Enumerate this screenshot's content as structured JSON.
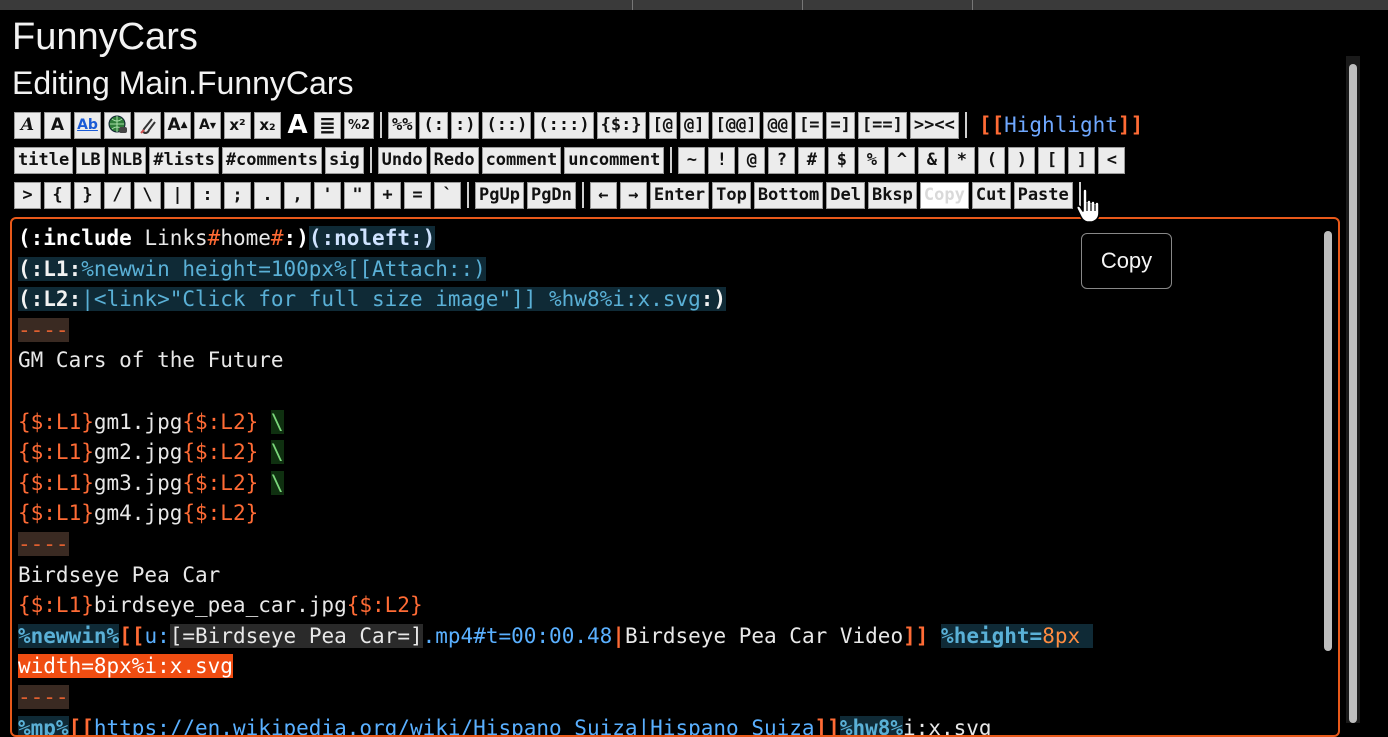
{
  "page": {
    "site_title": "FunnyCars",
    "edit_title": "Editing Main.FunnyCars"
  },
  "toolbar": {
    "row1_icons": [
      {
        "label": "A",
        "icon": "italic-icon"
      },
      {
        "label": "A",
        "icon": "bold-icon"
      },
      {
        "label": "Ab",
        "icon": "underline-icon"
      },
      {
        "label": "",
        "icon": "link-globe-icon"
      },
      {
        "label": "",
        "icon": "attach-paperclip-icon"
      },
      {
        "label": "A",
        "icon": "bigger-text-icon"
      },
      {
        "label": "A",
        "icon": "smaller-text-icon"
      },
      {
        "label": "x²",
        "icon": "superscript-icon"
      },
      {
        "label": "x₂",
        "icon": "subscript-icon"
      },
      {
        "label": "A",
        "icon": "large-text-icon"
      },
      {
        "label": "≣",
        "icon": "center-align-icon"
      },
      {
        "label": "%2",
        "icon": "percent-style-icon"
      }
    ],
    "row1_pairs": [
      "%%",
      "(:",
      ":)",
      "(::)",
      "(:::)",
      "{$:}",
      "[@",
      "@]",
      "[@@]",
      "@@",
      "[=",
      "=]",
      "[==]",
      ">><<"
    ],
    "highlight": {
      "open": "[[",
      "label": "Highlight",
      "close": "]]"
    },
    "row2_cmds": [
      "title",
      "LB",
      "NLB",
      "#lists",
      "#comments",
      "sig"
    ],
    "row2_edit": [
      "Undo",
      "Redo",
      "comment",
      "uncomment"
    ],
    "row2_chars": [
      "~",
      "!",
      "@",
      "?",
      "#",
      "$",
      "%",
      "^",
      "&",
      "*",
      "(",
      ")",
      "[",
      "]",
      "<"
    ],
    "row3_chars": [
      ">",
      "{",
      "}",
      "/",
      "\\",
      "|",
      ":",
      ";",
      ".",
      ",",
      "'",
      "\"",
      "+",
      "=",
      "`"
    ],
    "row3_nav": [
      "PgUp",
      "PgDn"
    ],
    "row3_keys": [
      "←",
      "→",
      "Enter",
      "Top",
      "Bottom",
      "Del",
      "Bksp",
      "Copy",
      "Cut",
      "Paste"
    ]
  },
  "tooltip": {
    "text": "Copy"
  },
  "editor": {
    "lines": [
      [
        {
          "t": "(:include",
          "c": "inc"
        },
        {
          "t": " Links",
          "c": ""
        },
        {
          "t": "#",
          "c": "hash"
        },
        {
          "t": "home",
          "c": ""
        },
        {
          "t": "#",
          "c": "hash"
        },
        {
          "t": ":)",
          "c": "inc"
        },
        {
          "t": "(:noleft:)",
          "c": "d"
        }
      ],
      [
        {
          "t": "(:L1:",
          "c": "dp"
        },
        {
          "t": "%newwin height=100px%[[Attach::)",
          "c": "dv"
        }
      ],
      [
        {
          "t": "(:L2:",
          "c": "dp"
        },
        {
          "t": "|<link>\"Click for full size image\"]] %hw8%i:x.svg",
          "c": "dv"
        },
        {
          "t": ":)",
          "c": "dp"
        }
      ],
      [
        {
          "t": "----",
          "c": "hr"
        }
      ],
      [
        {
          "t": "GM Cars of the Future",
          "c": ""
        }
      ],
      [
        {
          "t": "",
          "c": ""
        }
      ],
      [
        {
          "t": "{$:L1}",
          "c": "ph"
        },
        {
          "t": "gm1.jpg",
          "c": ""
        },
        {
          "t": "{$:L2}",
          "c": "ph"
        },
        {
          "t": " ",
          "c": ""
        },
        {
          "t": "\\",
          "c": "bs"
        }
      ],
      [
        {
          "t": "{$:L1}",
          "c": "ph"
        },
        {
          "t": "gm2.jpg",
          "c": ""
        },
        {
          "t": "{$:L2}",
          "c": "ph"
        },
        {
          "t": " ",
          "c": ""
        },
        {
          "t": "\\",
          "c": "bs"
        }
      ],
      [
        {
          "t": "{$:L1}",
          "c": "ph"
        },
        {
          "t": "gm3.jpg",
          "c": ""
        },
        {
          "t": "{$:L2}",
          "c": "ph"
        },
        {
          "t": " ",
          "c": ""
        },
        {
          "t": "\\",
          "c": "bs"
        }
      ],
      [
        {
          "t": "{$:L1}",
          "c": "ph"
        },
        {
          "t": "gm4.jpg",
          "c": ""
        },
        {
          "t": "{$:L2}",
          "c": "ph"
        }
      ],
      [
        {
          "t": "----",
          "c": "hr"
        }
      ],
      [
        {
          "t": "Birdseye Pea Car",
          "c": ""
        }
      ],
      [
        {
          "t": "{$:L1}",
          "c": "ph"
        },
        {
          "t": "birdseye_pea_car.jpg",
          "c": ""
        },
        {
          "t": "{$:L2}",
          "c": "ph"
        }
      ],
      [
        {
          "t": "%newwin%",
          "c": "pct"
        },
        {
          "t": "[[",
          "c": "br2"
        },
        {
          "t": "u:",
          "c": "lk"
        },
        {
          "t": "[=Birdseye Pea Car=]",
          "c": "esc"
        },
        {
          "t": ".mp4#t=00:00.48",
          "c": "lk"
        },
        {
          "t": "|",
          "c": "br2"
        },
        {
          "t": "Birdseye Pea Car Video",
          "c": ""
        },
        {
          "t": "]]",
          "c": "br2"
        },
        {
          "t": " ",
          "c": ""
        },
        {
          "t": "%height=",
          "c": "pct"
        },
        {
          "t": "8px ",
          "c": "pv"
        }
      ],
      [
        {
          "t": "width=8px%i:x.svg",
          "c": "sel"
        }
      ],
      [
        {
          "t": "----",
          "c": "hr"
        }
      ],
      [
        {
          "t": "%mp%",
          "c": "pct"
        },
        {
          "t": "[[",
          "c": "br2"
        },
        {
          "t": "https://en.wikipedia.org/wiki/Hispano_Suiza|Hispano Suiza",
          "c": "lk"
        },
        {
          "t": "]]",
          "c": "br2"
        },
        {
          "t": "%hw8%",
          "c": "pct"
        },
        {
          "t": "i:x.svg",
          "c": ""
        }
      ]
    ]
  }
}
